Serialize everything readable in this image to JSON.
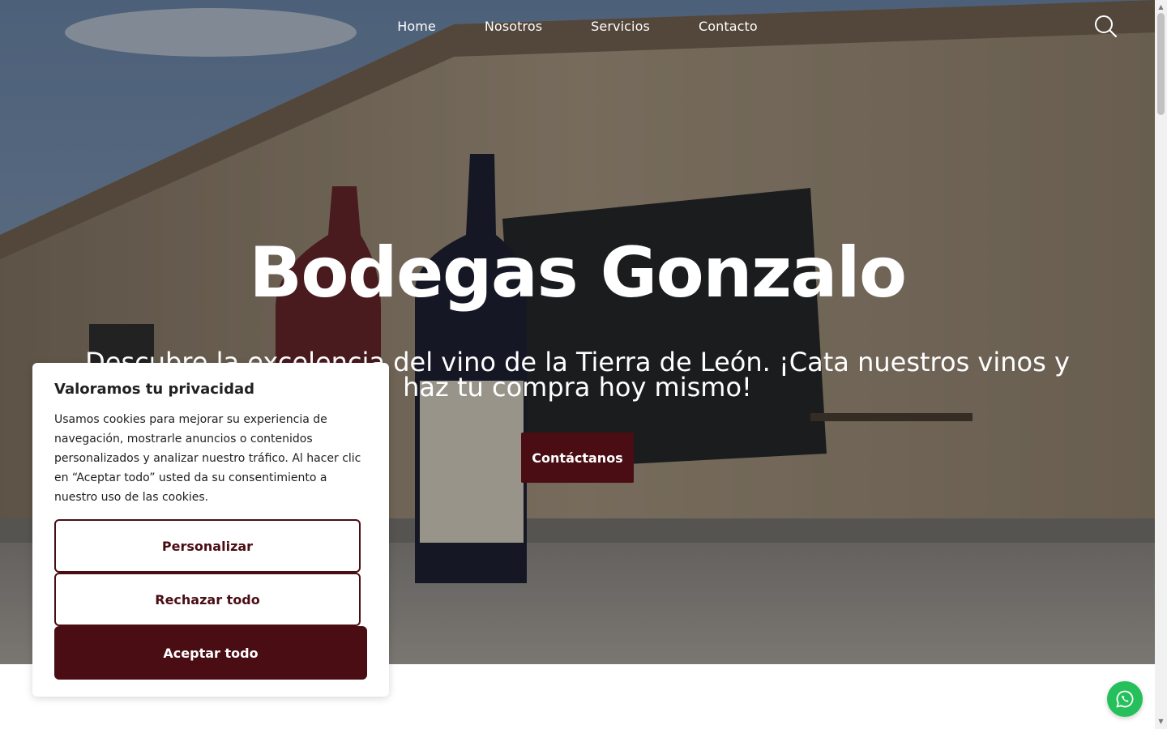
{
  "nav": {
    "items": [
      {
        "label": "Home"
      },
      {
        "label": "Nosotros"
      },
      {
        "label": "Servicios"
      },
      {
        "label": "Contacto"
      }
    ],
    "search_icon": "search-icon"
  },
  "hero": {
    "title": "Bodegas Gonzalo",
    "subtitle": "Descubre la excelencia del vino de la Tierra de León. ¡Cata nuestros vinos y haz tu compra hoy mismo!",
    "cta_label": "Contáctanos"
  },
  "cookie": {
    "title": "Valoramos tu privacidad",
    "text": "Usamos cookies para mejorar su experiencia de navegación, mostrarle anuncios o contenidos personalizados y analizar nuestro tráfico. Al hacer clic en “Aceptar todo” usted da su consentimiento a nuestro uso de las cookies.",
    "customize_label": "Personalizar",
    "reject_label": "Rechazar todo",
    "accept_label": "Aceptar todo"
  },
  "whatsapp_icon": "whatsapp-icon",
  "colors": {
    "brand": "#4a0d14",
    "whatsapp": "#25c05c"
  }
}
